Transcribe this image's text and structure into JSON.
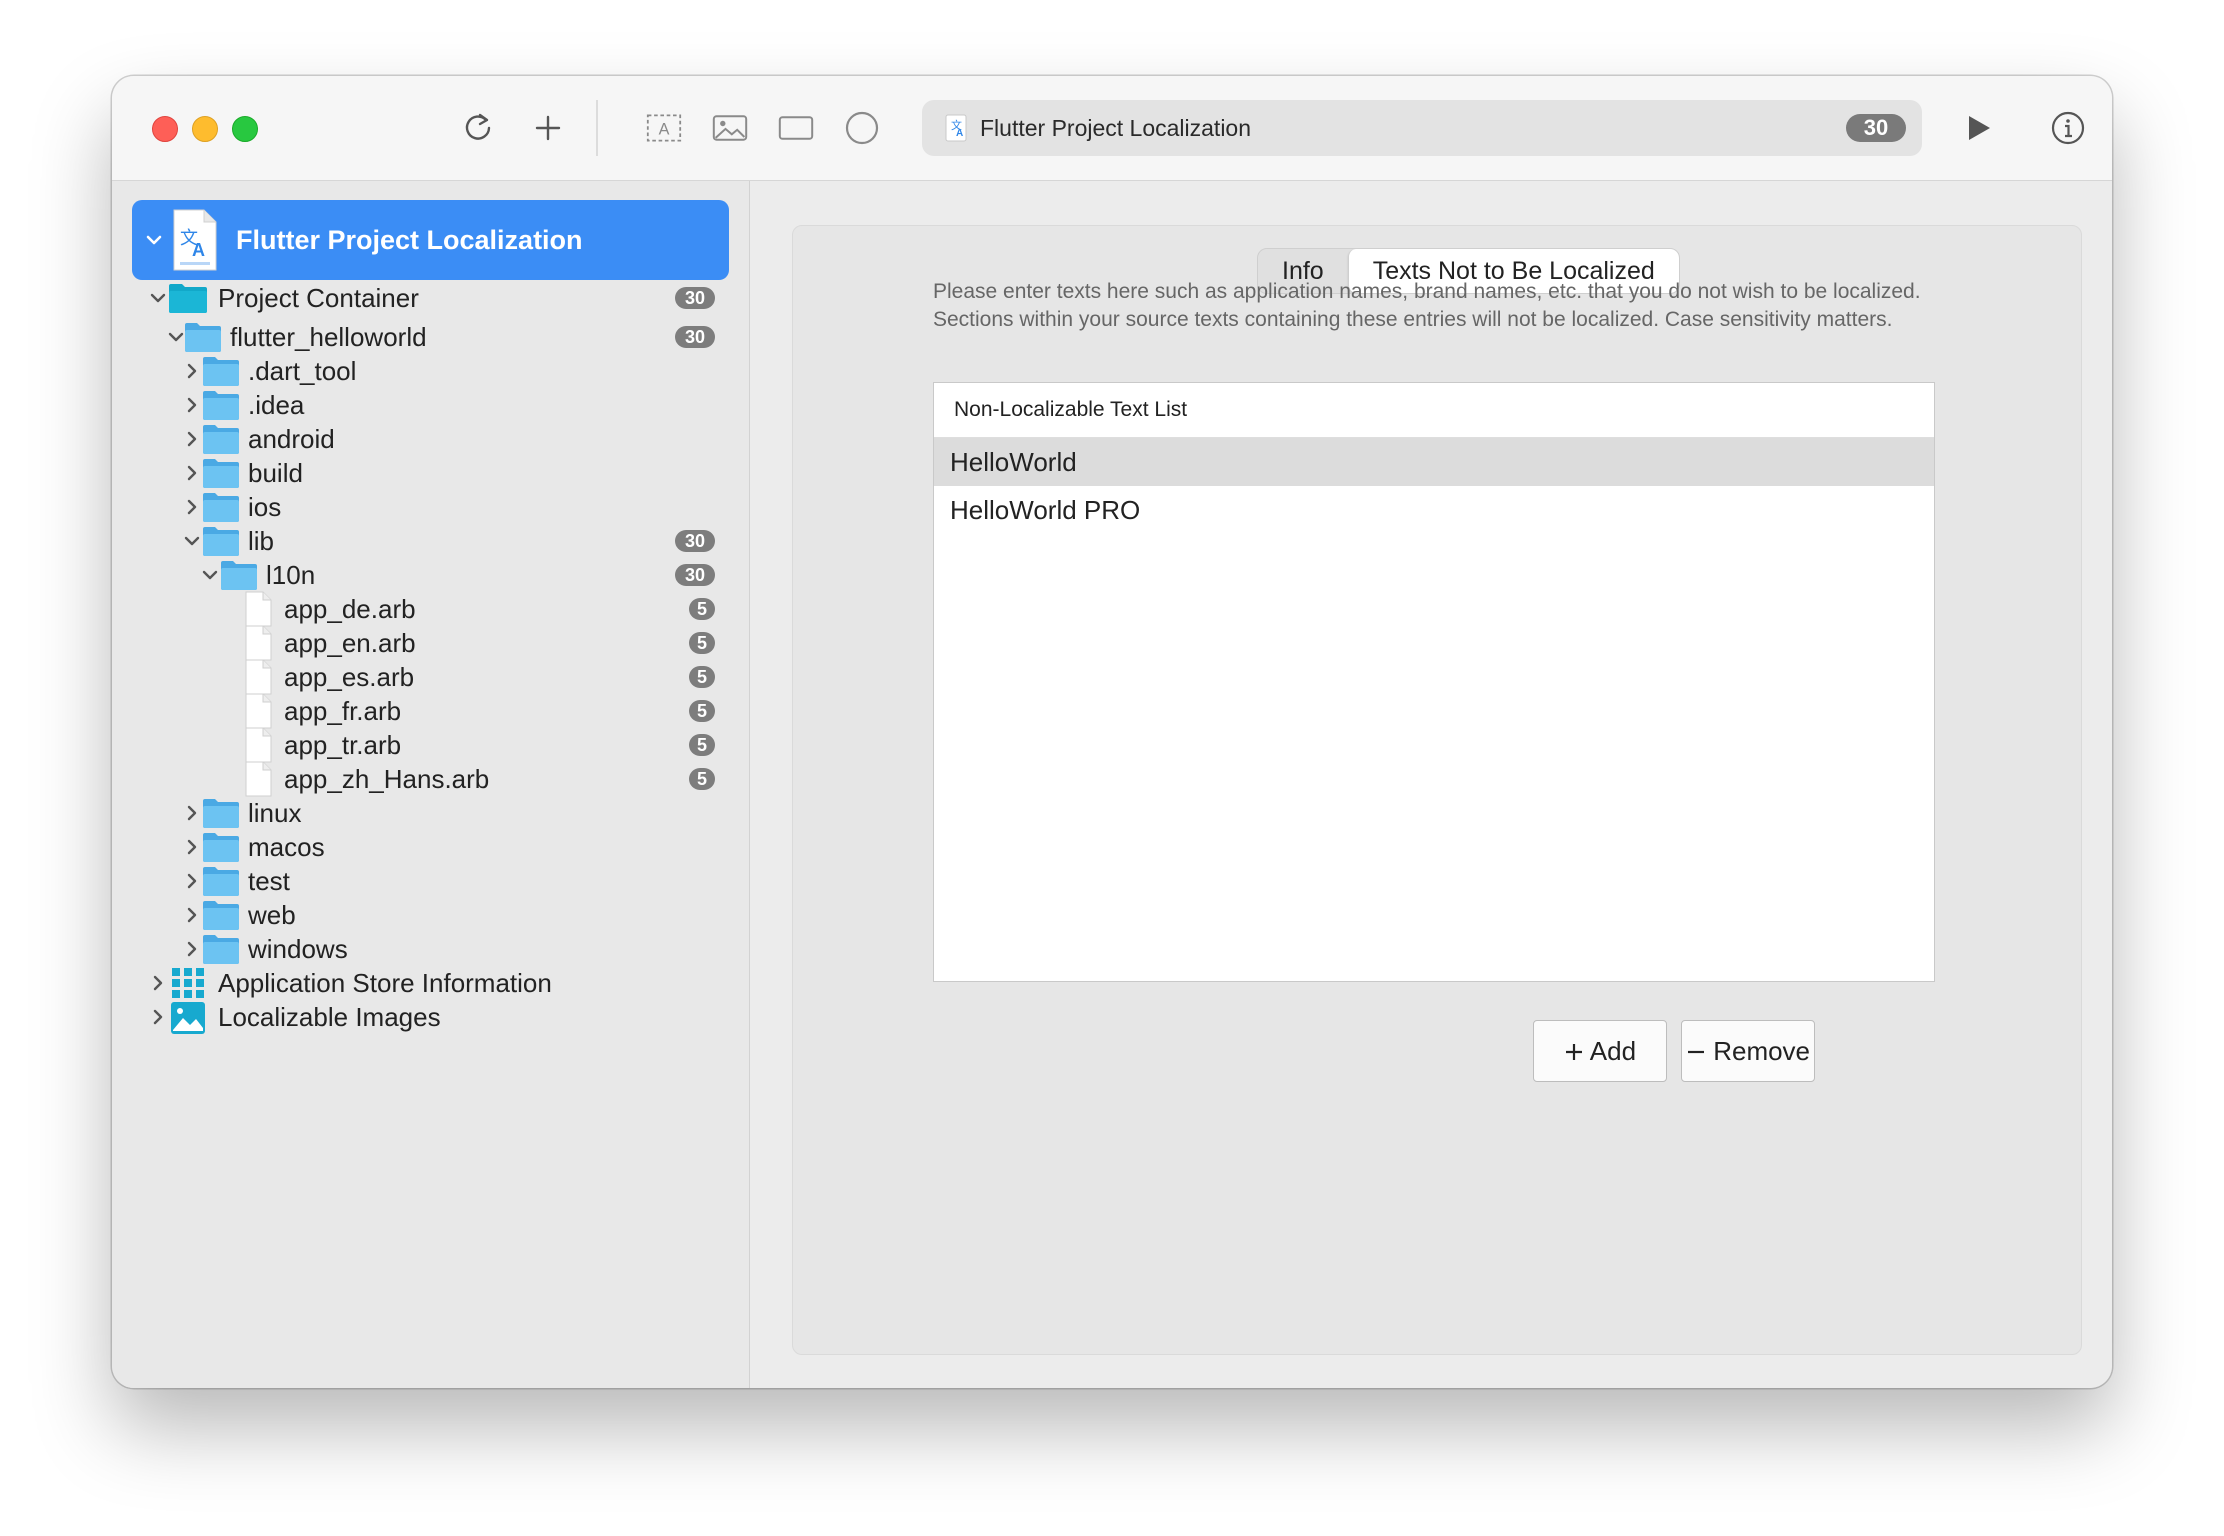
{
  "toolbar": {
    "address_title": "Flutter Project Localization",
    "address_badge": "30",
    "icons": [
      "refresh-icon",
      "plus-icon",
      "text-box-icon",
      "image-icon",
      "rectangle-icon",
      "circle-icon",
      "play-icon",
      "info-icon"
    ]
  },
  "sidebar": {
    "project_title": "Flutter Project Localization",
    "tree": {
      "project_container": {
        "label": "Project Container",
        "badge": "30"
      },
      "flutter_helloworld": {
        "label": "flutter_helloworld",
        "badge": "30"
      },
      "dart_tool": {
        "label": ".dart_tool"
      },
      "idea": {
        "label": ".idea"
      },
      "android": {
        "label": "android"
      },
      "build": {
        "label": "build"
      },
      "ios": {
        "label": "ios"
      },
      "lib": {
        "label": "lib",
        "badge": "30"
      },
      "l10n": {
        "label": "l10n",
        "badge": "30"
      },
      "files": [
        {
          "label": "app_de.arb",
          "badge": "5"
        },
        {
          "label": "app_en.arb",
          "badge": "5"
        },
        {
          "label": "app_es.arb",
          "badge": "5"
        },
        {
          "label": "app_fr.arb",
          "badge": "5"
        },
        {
          "label": "app_tr.arb",
          "badge": "5"
        },
        {
          "label": "app_zh_Hans.arb",
          "badge": "5"
        }
      ],
      "linux": {
        "label": "linux"
      },
      "macos": {
        "label": "macos"
      },
      "test": {
        "label": "test"
      },
      "web": {
        "label": "web"
      },
      "windows": {
        "label": "windows"
      },
      "app_store": {
        "label": "Application Store Information"
      },
      "images": {
        "label": "Localizable Images"
      }
    }
  },
  "main": {
    "tabs": {
      "info": "Info",
      "texts_not_localized": "Texts Not to Be Localized"
    },
    "description": "Please enter texts here such as application names, brand names, etc. that you do not wish to be localized. Sections within your source texts containing these entries will not be localized. Case sensitivity matters.",
    "list_header": "Non-Localizable Text List",
    "entries": [
      "HelloWorld",
      "HelloWorld PRO"
    ],
    "add_label": "Add",
    "remove_label": "Remove"
  },
  "colors": {
    "accent": "#3b8df5",
    "folder": "#5ab8ee",
    "badge": "#7d7d7d",
    "close": "#fe5f57",
    "minimize": "#febc2e",
    "zoom": "#28c840"
  }
}
